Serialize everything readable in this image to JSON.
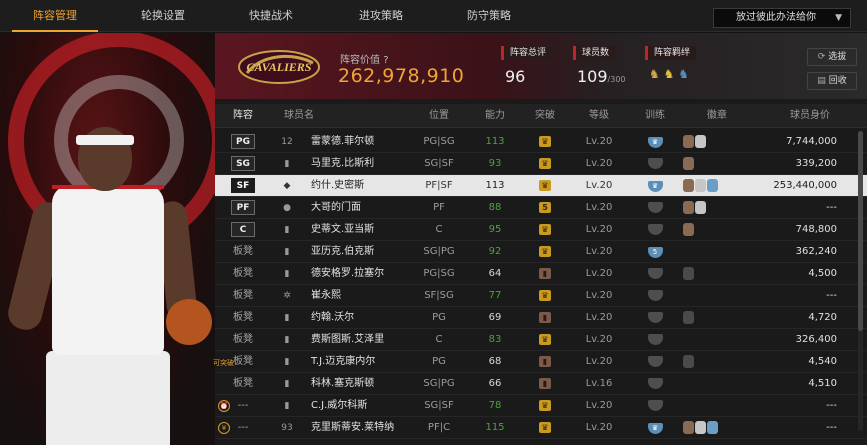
{
  "tabs": [
    {
      "label": "阵容管理",
      "active": true
    },
    {
      "label": "轮换设置",
      "active": false
    },
    {
      "label": "快捷战术",
      "active": false
    },
    {
      "label": "进攻策略",
      "active": false
    },
    {
      "label": "防守策略",
      "active": false
    }
  ],
  "dropdown": {
    "value": "放过彼此办法给你"
  },
  "team": {
    "value_label": "阵容价值",
    "value": "262,978,910",
    "logo_text": "CAVALIERS"
  },
  "stats": {
    "overall_label": "阵容总评",
    "overall": "96",
    "count_label": "球员数",
    "count": "109",
    "count_max": "/300",
    "bonds_label": "阵容羁绊"
  },
  "buttons": {
    "select": "选拔",
    "recycle": "回收"
  },
  "columns": {
    "lineup": "阵容",
    "name": "球员名",
    "position": "位置",
    "ability": "能力",
    "breakthrough": "突破",
    "level": "等级",
    "training": "训练",
    "badges": "徽章",
    "salary": "球员身价"
  },
  "rows": [
    {
      "slot": "PG",
      "starter": true,
      "mark": "12",
      "name": "雷蒙德.菲尔顿",
      "pos": "PG|SG",
      "ability": "113",
      "green": true,
      "brk": "crown",
      "lvl": "Lv.20",
      "train": "crown",
      "badges": [
        "br",
        "sv"
      ],
      "salary": "7,744,000"
    },
    {
      "slot": "SG",
      "starter": true,
      "mark": "▮",
      "name": "马里克.比斯利",
      "pos": "SG|SF",
      "ability": "93",
      "green": true,
      "brk": "crown",
      "lvl": "Lv.20",
      "train": "blank",
      "badges": [
        "br"
      ],
      "salary": "339,200"
    },
    {
      "slot": "SF",
      "starter": true,
      "selected": true,
      "mark": "◆",
      "name": "约什.史密斯",
      "pos": "PF|SF",
      "ability": "113",
      "green": false,
      "brk": "crown",
      "lvl": "Lv.20",
      "train": "crown",
      "badges": [
        "br",
        "sv",
        "bu"
      ],
      "salary": "253,440,000"
    },
    {
      "slot": "PF",
      "starter": true,
      "mark": "●",
      "name": "大哥的门面",
      "pos": "PF",
      "ability": "88",
      "green": true,
      "brk": "5",
      "lvl": "Lv.20",
      "train": "blank",
      "badges": [
        "br",
        "sv"
      ],
      "salary": "---"
    },
    {
      "slot": "C",
      "starter": true,
      "mark": "▮",
      "name": "史蒂文.亚当斯",
      "pos": "C",
      "ability": "95",
      "green": true,
      "brk": "crown",
      "lvl": "Lv.20",
      "train": "blank",
      "badges": [
        "br"
      ],
      "salary": "748,800"
    },
    {
      "slot": "板凳",
      "starter": false,
      "mark": "▮",
      "name": "亚历克.伯克斯",
      "pos": "SG|PG",
      "ability": "92",
      "green": true,
      "brk": "crown",
      "lvl": "Lv.20",
      "train": "5",
      "badges": [],
      "salary": "362,240"
    },
    {
      "slot": "板凳",
      "starter": false,
      "mark": "▮",
      "name": "德安格罗.拉塞尔",
      "pos": "PG|SG",
      "ability": "64",
      "green": false,
      "brk": "b",
      "lvl": "Lv.20",
      "train": "blank",
      "badges": [
        "dk"
      ],
      "salary": "4,500"
    },
    {
      "slot": "板凳",
      "starter": false,
      "mark": "✲",
      "name": "崔永熙",
      "pos": "SF|SG",
      "ability": "77",
      "green": true,
      "brk": "crown",
      "lvl": "Lv.20",
      "train": "blank",
      "badges": [],
      "salary": "---"
    },
    {
      "slot": "板凳",
      "starter": false,
      "mark": "▮",
      "name": "约翰.沃尔",
      "pos": "PG",
      "ability": "69",
      "green": false,
      "brk": "b",
      "lvl": "Lv.20",
      "train": "blank",
      "badges": [
        "dk"
      ],
      "salary": "4,720"
    },
    {
      "slot": "板凳",
      "starter": false,
      "mark": "▮",
      "name": "费斯图斯.艾泽里",
      "pos": "C",
      "ability": "83",
      "green": true,
      "brk": "crown",
      "lvl": "Lv.20",
      "train": "blank",
      "badges": [],
      "salary": "326,400"
    },
    {
      "slot": "板凳",
      "starter": false,
      "tag": "可突破",
      "mark": "▮",
      "name": "T.J.迈克康内尔",
      "pos": "PG",
      "ability": "68",
      "green": false,
      "brk": "b",
      "lvl": "Lv.20",
      "train": "blank",
      "badges": [
        "dk"
      ],
      "salary": "4,540"
    },
    {
      "slot": "板凳",
      "starter": false,
      "mark": "▮",
      "name": "科林.塞克斯顿",
      "pos": "SG|PG",
      "ability": "66",
      "green": false,
      "brk": "b",
      "lvl": "Lv.16",
      "train": "blank",
      "badges": [],
      "salary": "4,510"
    },
    {
      "slot": "---",
      "starter": false,
      "icon": "alarm",
      "mark": "▮",
      "name": "C.J.威尔科斯",
      "pos": "SG|SF",
      "ability": "78",
      "green": true,
      "brk": "crown",
      "lvl": "Lv.20",
      "train": "blank",
      "badges": [],
      "salary": "---"
    },
    {
      "slot": "---",
      "starter": false,
      "icon": "coin",
      "mark": "93",
      "name": "克里斯蒂安.莱特纳",
      "pos": "PF|C",
      "ability": "115",
      "green": true,
      "brk": "crown",
      "lvl": "Lv.20",
      "train": "crown",
      "badges": [
        "br",
        "sv",
        "bu"
      ],
      "salary": "---"
    }
  ],
  "colors": {
    "accent": "#f0a431",
    "ability_green": "#4ea33b",
    "team_red": "#c4222a"
  }
}
